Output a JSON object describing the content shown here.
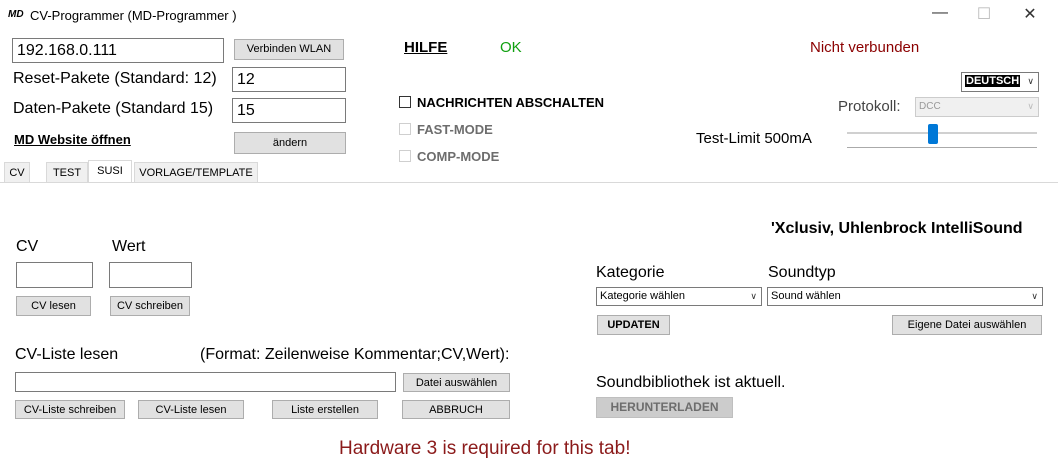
{
  "window": {
    "icon": "MD",
    "title": "CV-Programmer (MD-Programmer  )",
    "minimize_glyph": "—",
    "maximize_glyph": "☐",
    "close_glyph": "✕"
  },
  "connection": {
    "ip": "192.168.0.111",
    "connect_label": "Verbinden WLAN",
    "help": "HILFE",
    "ok": "OK",
    "status": "Nicht verbunden"
  },
  "settings": {
    "reset_label": "Reset-Pakete (Standard: 12)",
    "reset_value": "12",
    "data_label": "Daten-Pakete (Standard 15)",
    "data_value": "15",
    "website_link": "MD Website öffnen",
    "change_label": "ändern",
    "language": "DEUTSCH",
    "protocol_label": "Protokoll:",
    "protocol_value": "DCC",
    "test_limit_label": "Test-Limit 500mA",
    "test_limit_fraction": 0.45
  },
  "checkboxes": {
    "messages_off": "NACHRICHTEN ABSCHALTEN",
    "fast_mode": "FAST-MODE",
    "comp_mode": "COMP-MODE"
  },
  "tabs": [
    "CV",
    "TEST",
    "SUSI",
    "VORLAGE/TEMPLATE"
  ],
  "susi": {
    "cv_label": "CV",
    "value_label": "Wert",
    "read_cv": "CV lesen",
    "write_cv": "CV schreiben",
    "list_label": "CV-Liste lesen",
    "list_format": "(Format: Zeilenweise Kommentar;CV,Wert):",
    "choose_file": "Datei auswählen",
    "write_list": "CV-Liste schreiben",
    "read_list": "CV-Liste lesen",
    "create_list": "Liste erstellen",
    "abort": "ABBRUCH",
    "sound_heading": "'Xclusiv, Uhlenbrock IntelliSound",
    "category_label": "Kategorie",
    "category_value": "Kategorie wählen",
    "soundtype_label": "Soundtyp",
    "soundtype_value": "Sound wählen",
    "update": "UPDATEN",
    "own_file": "Eigene Datei auswählen",
    "library_status": "Soundbibliothek ist aktuell.",
    "download": "HERUNTERLADEN",
    "hardware_notice": "Hardware 3 is required for this tab!"
  },
  "colors": {
    "ok": "#10a010",
    "status": "#8b0000",
    "notice": "#8b1a1a",
    "slider_thumb": "#0078d7"
  }
}
